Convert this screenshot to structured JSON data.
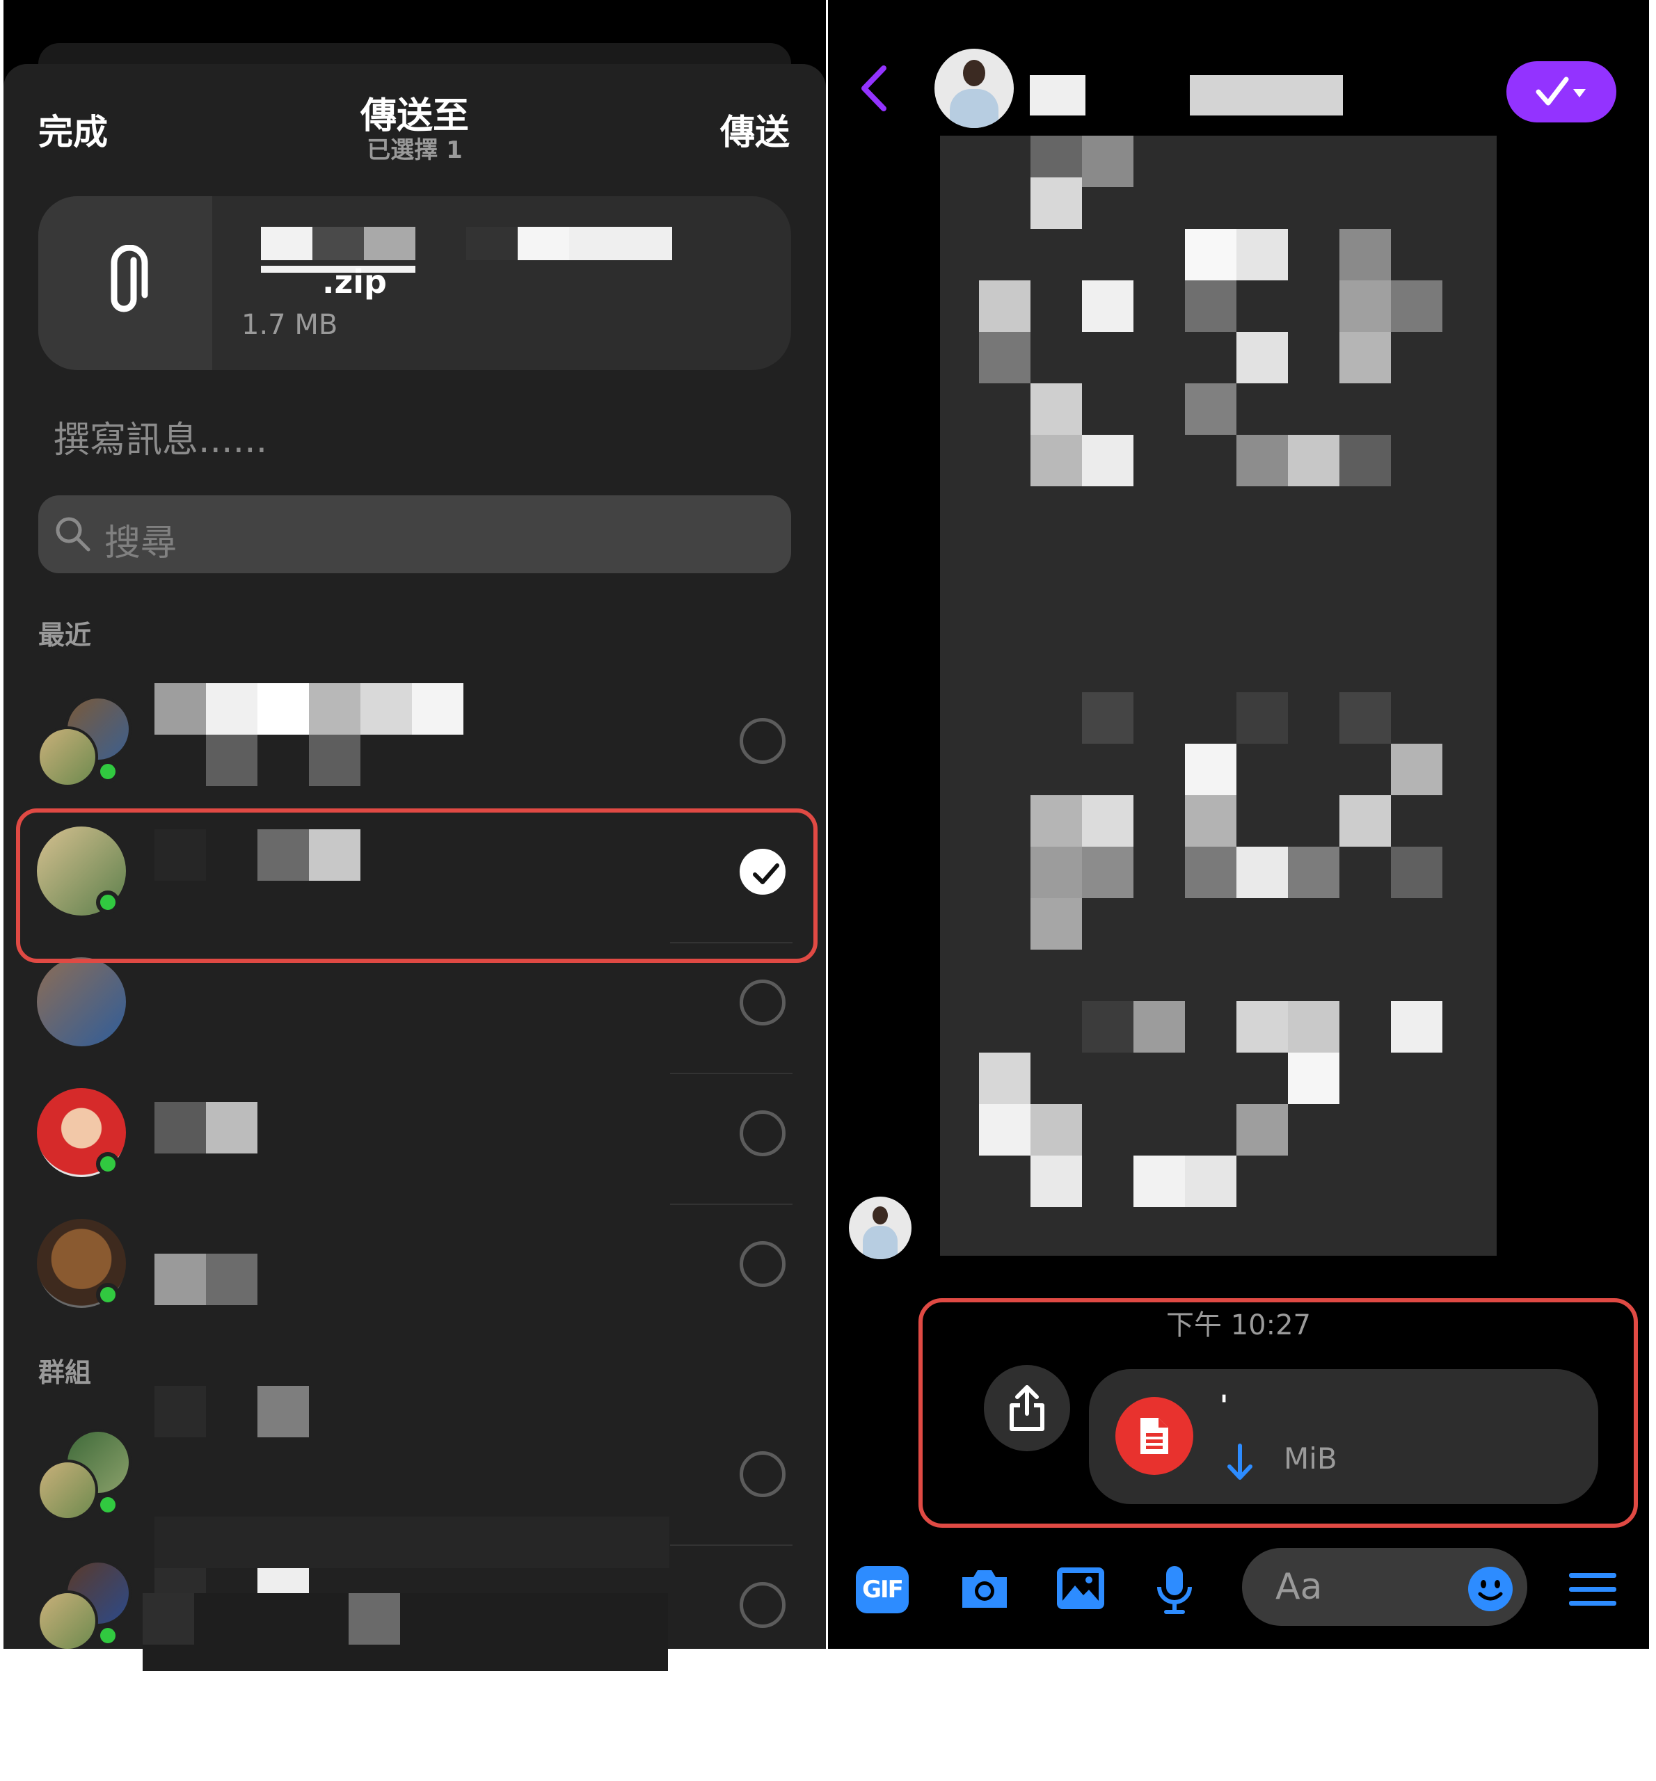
{
  "share_sheet": {
    "done_label": "完成",
    "send_label": "傳送",
    "title": "傳送至",
    "subtitle": "已選擇 1",
    "attachment": {
      "icon": "paperclip-icon",
      "name": ".zip",
      "size": "1.7 MB"
    },
    "compose_placeholder": "撰寫訊息......",
    "search_placeholder": "搜尋",
    "sections": {
      "recent": "最近",
      "groups": "群組"
    },
    "recent_contacts": [
      {
        "online": true,
        "selected": false
      },
      {
        "online": true,
        "selected": true
      },
      {
        "online": false,
        "selected": false
      },
      {
        "online": true,
        "selected": false
      },
      {
        "online": true,
        "selected": false
      }
    ],
    "group_contacts": [
      {
        "online": true,
        "selected": false
      },
      {
        "online": true,
        "selected": false
      }
    ]
  },
  "chat": {
    "timestamp": "下午 10:27",
    "file_message": {
      "name": "'",
      "size": "MiB",
      "icon": "document-icon"
    },
    "toolbar": {
      "gif_label": "GIF",
      "input_placeholder": "Aa"
    },
    "colors": {
      "accent_purple": "#9333ff",
      "accent_blue": "#2d8cff",
      "highlight_red": "#e04a44",
      "online_green": "#31c940"
    }
  }
}
